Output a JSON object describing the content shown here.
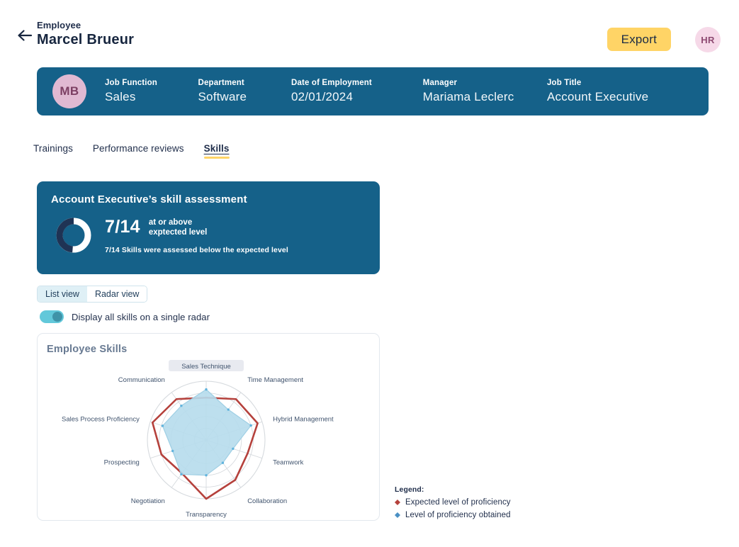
{
  "header": {
    "back_icon": "arrow-left-icon",
    "eyebrow": "Employee",
    "title": "Marcel Brueur",
    "export_label": "Export",
    "avatar_initials": "HR"
  },
  "info_banner": {
    "avatar_initials": "MB",
    "fields": [
      {
        "label": "Job Function",
        "value": "Sales"
      },
      {
        "label": "Department",
        "value": "Software"
      },
      {
        "label": "Date of Employment",
        "value": "02/01/2024"
      },
      {
        "label": "Manager",
        "value": "Mariama Leclerc"
      },
      {
        "label": "Job Title",
        "value": "Account Executive"
      }
    ]
  },
  "tabs": [
    {
      "label": "Trainings",
      "active": false
    },
    {
      "label": "Performance reviews",
      "active": false
    },
    {
      "label": "Skills",
      "active": true
    }
  ],
  "assessment": {
    "title": "Account Executive’s skill assessment",
    "fraction": "7/14",
    "subtitle_line1": "at or above",
    "subtitle_line2": "exptected level",
    "note": "7/14 Skills were assessed below the expected level",
    "donut_percent": 50,
    "donut_filled_color": "#1f3354",
    "donut_empty_color": "#ffffff"
  },
  "view_toggle": {
    "options": [
      {
        "label": "List view",
        "active": false
      },
      {
        "label": "Radar view",
        "active": true
      }
    ]
  },
  "single_radar_switch": {
    "label": "Display all skills on a single radar",
    "on": true
  },
  "radar_card": {
    "title": "Employee Skills",
    "highlighted_axis": "Sales Technique"
  },
  "legend": {
    "title": "Legend:",
    "items": [
      {
        "label": "Expected level of proficiency",
        "color": "#b5413c",
        "marker": "diamond-icon"
      },
      {
        "label": "Level of proficiency obtained",
        "color": "#4a90c4",
        "marker": "diamond-icon"
      }
    ]
  },
  "colors": {
    "brand_blue": "#156189",
    "accent_yellow": "#ffd466",
    "expected_red": "#b5413c",
    "obtained_blue_fill": "#b6dcec",
    "obtained_blue_stroke": "#9fcfe4",
    "grid_gray": "#d6dade",
    "text_dark": "#1f2d4a"
  },
  "chart_data": {
    "type": "radar",
    "title": "Employee Skills",
    "categories": [
      "Sales Technique",
      "Time Management",
      "Hybrid Management",
      "Teamwork",
      "Collaboration",
      "Transparency",
      "Negotiation",
      "Prospecting",
      "Sales Process Proficiency",
      "Communication"
    ],
    "rmax": 5,
    "rings": 5,
    "grid": true,
    "legend_position": "outside-right",
    "series": [
      {
        "name": "Expected level of proficiency",
        "color": "#b5413c",
        "fill": "none",
        "values": [
          3.6,
          4.3,
          4.6,
          3.7,
          4.2,
          5.0,
          3.5,
          4.0,
          4.8,
          4.3
        ]
      },
      {
        "name": "Level of proficiency obtained",
        "color": "#9fcfe4",
        "fill": "#b6dcec",
        "values": [
          4.3,
          3.2,
          4.0,
          2.4,
          2.4,
          3.0,
          3.6,
          3.0,
          3.9,
          3.6
        ]
      }
    ]
  }
}
